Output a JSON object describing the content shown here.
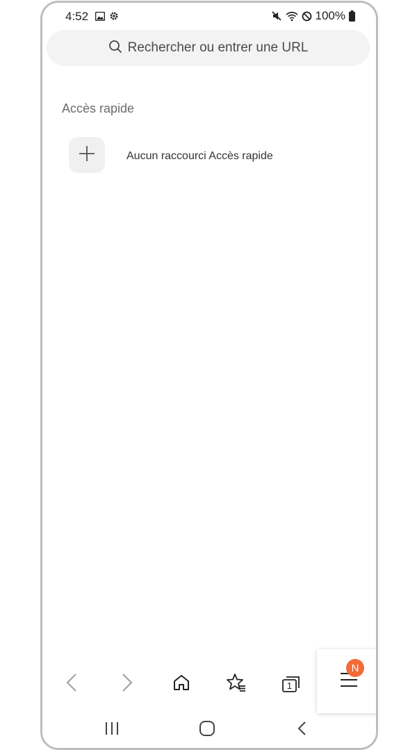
{
  "status_bar": {
    "time": "4:52",
    "battery": "100%",
    "icons": [
      "gallery-icon",
      "settings-gear-icon",
      "mute-icon",
      "wifi-icon",
      "do-not-disturb-icon",
      "battery-icon"
    ]
  },
  "search": {
    "placeholder": "Rechercher ou entrer une URL"
  },
  "quick_access": {
    "title": "Accès rapide",
    "empty_message": "Aucun raccourci Accès rapide"
  },
  "toolbar": {
    "items": [
      "back-icon",
      "forward-icon",
      "home-icon",
      "bookmarks-icon",
      "tabs-icon",
      "menu-icon"
    ],
    "tab_count": "1",
    "badge": "N"
  },
  "navbar": {
    "items": [
      "recents-icon",
      "home-button-icon",
      "system-back-icon"
    ]
  },
  "colors": {
    "badge": "#f26b3a",
    "search_bg": "#f3f3f3",
    "frame_border": "#bdbdbd"
  }
}
